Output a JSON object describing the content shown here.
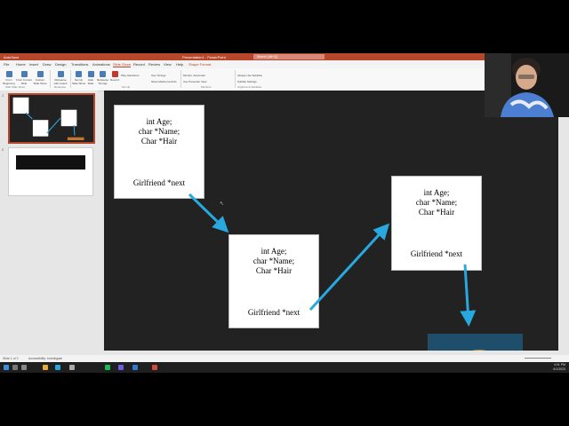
{
  "window": {
    "autosave": "AutoSave",
    "title": "Presentation1 - PowerPoint",
    "search_placeholder": "Search (Alt+Q)"
  },
  "tabs": [
    "File",
    "Home",
    "Insert",
    "Draw",
    "Design",
    "Transitions",
    "Animations",
    "Slide Show",
    "Record",
    "Review",
    "View",
    "Help",
    "Shape Format"
  ],
  "active_tab": "Slide Show",
  "ribbon": {
    "buttons": [
      "From Beginning",
      "From Current Slide",
      "Custom Slide Show",
      "Rehearse with Coach",
      "Set Up Slide Show",
      "Hide Slide",
      "Rehearse Timings",
      "Record"
    ],
    "checks": [
      "Play Narrations",
      "Use Timings",
      "Show Media Controls",
      "Monitor: Automatic",
      "Use Presenter View",
      "Always Use Subtitles",
      "Subtitle Settings"
    ],
    "groups": [
      "Start Slide Show",
      "Rehearse",
      "Set Up",
      "Monitors",
      "Captions & Subtitles"
    ]
  },
  "thumbnails": {
    "numbers": [
      "1",
      "2"
    ]
  },
  "slide": {
    "nodes": [
      {
        "fields": [
          "int Age;",
          "char *Name;",
          "Char *Hair"
        ],
        "next": "Girlfriend *next"
      },
      {
        "fields": [
          "int Age;",
          "char *Name;",
          "Char *Hair"
        ],
        "next": "Girlfriend *next"
      },
      {
        "fields": [
          "int Age;",
          "char *Name;",
          "Char *Hair"
        ],
        "next": "Girlfriend *next"
      }
    ],
    "arrow_color": "#29a8e0",
    "image": "hotdog-photo"
  },
  "statusbar": {
    "left": "Slide 1 of 2",
    "accessibility": "Accessibility: Investigate"
  },
  "taskbar": {
    "time": "4:01 PM",
    "date": "6/1/2023"
  },
  "colors": {
    "accent": "#b7472a",
    "slide_bg": "#222222"
  }
}
